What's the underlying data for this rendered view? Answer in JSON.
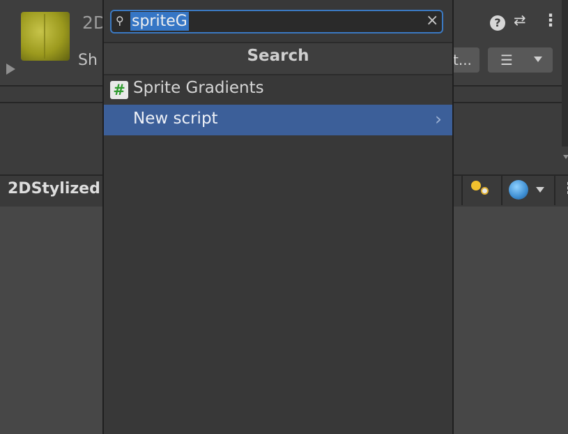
{
  "inspector": {
    "asset_title": "2D",
    "shader_label": "Sh",
    "select_button_label": "t...",
    "list_icon": "list-icon",
    "help_icon_glyph": "?",
    "presets_icon_glyph": "⇄",
    "kebab_glyph": "⋮"
  },
  "preview": {
    "title": "2DStylized",
    "kebab_glyph": "⋮"
  },
  "popup": {
    "search_value": "spriteG",
    "clear_glyph": "×",
    "header": "Search",
    "items": [
      {
        "label": "Sprite Gradients",
        "icon_glyph": "#"
      },
      {
        "label": "New script",
        "chevron": "›"
      }
    ]
  },
  "colors": {
    "selection": "#3c5f99",
    "search_highlight": "#3676c5",
    "focus_border": "#3b79c2",
    "script_icon_green": "#2e9b2e"
  }
}
